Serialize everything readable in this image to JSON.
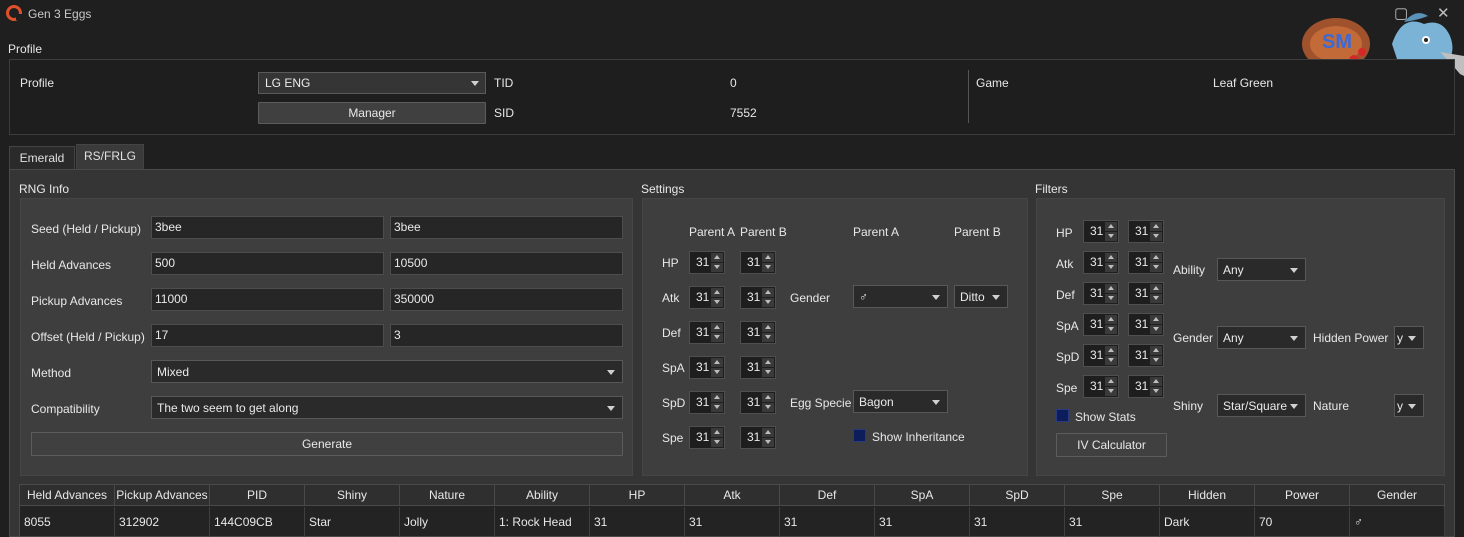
{
  "window": {
    "title": "Gen 3 Eggs",
    "minimize_glyph": "▢",
    "close_glyph": "✕"
  },
  "profile": {
    "group_title": "Profile",
    "profile_label": "Profile",
    "profile_value": "LG ENG",
    "manager_label": "Manager",
    "tid_label": "TID",
    "tid_value": "0",
    "sid_label": "SID",
    "sid_value": "7552",
    "game_label": "Game",
    "game_value": "Leaf Green"
  },
  "tabs": [
    {
      "label": "Emerald"
    },
    {
      "label": "RS/FRLG"
    }
  ],
  "rng": {
    "title": "RNG Info",
    "rows": [
      {
        "label": "Seed (Held / Pickup)",
        "held": "3bee",
        "pickup": "3bee"
      },
      {
        "label": "Held Advances",
        "held": "500",
        "pickup": "10500"
      },
      {
        "label": "Pickup Advances",
        "held": "11000",
        "pickup": "350000"
      },
      {
        "label": "Offset (Held / Pickup)",
        "held": "17",
        "pickup": "3"
      }
    ],
    "method_label": "Method",
    "method_value": "Mixed",
    "compat_label": "Compatibility",
    "compat_value": "The two seem to get along",
    "generate_label": "Generate"
  },
  "settings": {
    "title": "Settings",
    "parent_a": "Parent A",
    "parent_b": "Parent B",
    "parent_a2": "Parent A",
    "parent_b2": "Parent B",
    "stats": [
      {
        "label": "HP",
        "a": "31",
        "b": "31"
      },
      {
        "label": "Atk",
        "a": "31",
        "b": "31"
      },
      {
        "label": "Def",
        "a": "31",
        "b": "31"
      },
      {
        "label": "SpA",
        "a": "31",
        "b": "31"
      },
      {
        "label": "SpD",
        "a": "31",
        "b": "31"
      },
      {
        "label": "Spe",
        "a": "31",
        "b": "31"
      }
    ],
    "gender_label": "Gender",
    "gender_a": "♂",
    "gender_b": "Ditto",
    "egg_label": "Egg Specie",
    "egg_value": "Bagon",
    "show_inheritance": "Show Inheritance"
  },
  "filters": {
    "title": "Filters",
    "stats": [
      {
        "label": "HP",
        "min": "31",
        "max": "31"
      },
      {
        "label": "Atk",
        "min": "31",
        "max": "31"
      },
      {
        "label": "Def",
        "min": "31",
        "max": "31"
      },
      {
        "label": "SpA",
        "min": "31",
        "max": "31"
      },
      {
        "label": "SpD",
        "min": "31",
        "max": "31"
      },
      {
        "label": "Spe",
        "min": "31",
        "max": "31"
      }
    ],
    "ability_label": "Ability",
    "ability_value": "Any",
    "gender_label": "Gender",
    "gender_value": "Any",
    "hidden_power_label": "Hidden Power",
    "hidden_power_value": "y",
    "shiny_label": "Shiny",
    "shiny_value": "Star/Square",
    "nature_label": "Nature",
    "nature_value": "y",
    "show_stats": "Show Stats",
    "iv_calc": "IV Calculator"
  },
  "results": {
    "columns": [
      "Held Advances",
      "Pickup Advances",
      "PID",
      "Shiny",
      "Nature",
      "Ability",
      "HP",
      "Atk",
      "Def",
      "SpA",
      "SpD",
      "Spe",
      "Hidden",
      "Power",
      "Gender"
    ],
    "rows": [
      [
        "8055",
        "312902",
        "144C09CB",
        "Star",
        "Jolly",
        "1: Rock Head",
        "31",
        "31",
        "31",
        "31",
        "31",
        "31",
        "Dark",
        "70",
        "♂"
      ]
    ]
  }
}
